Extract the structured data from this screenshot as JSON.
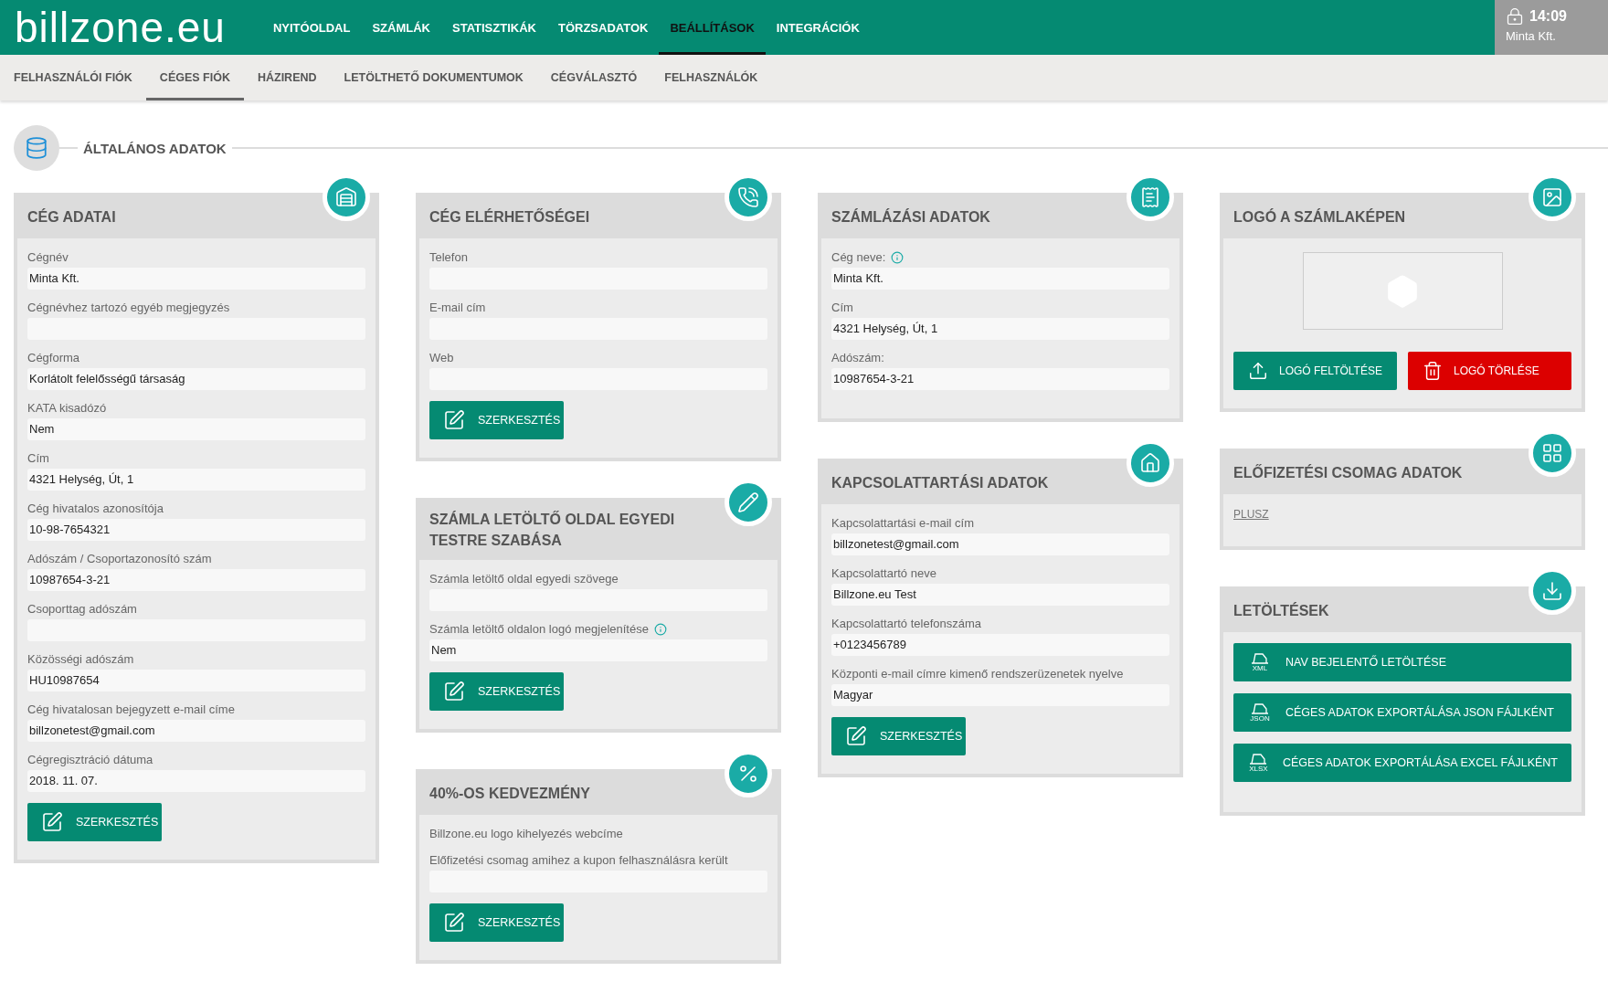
{
  "brand": "billzone.eu",
  "nav": [
    {
      "label": "NYITÓOLDAL",
      "selected": false
    },
    {
      "label": "SZÁMLÁK",
      "selected": false
    },
    {
      "label": "STATISZTIKÁK",
      "selected": false
    },
    {
      "label": "TÖRZSADATOK",
      "selected": false
    },
    {
      "label": "BEÁLLÍTÁSOK",
      "selected": true
    },
    {
      "label": "INTEGRÁCIÓK",
      "selected": false
    }
  ],
  "session": {
    "time": "14:09",
    "company": "Minta Kft."
  },
  "subnav": [
    {
      "label": "FELHASZNÁLÓI FIÓK",
      "selected": false
    },
    {
      "label": "CÉGES FIÓK",
      "selected": true
    },
    {
      "label": "HÁZIREND",
      "selected": false
    },
    {
      "label": "LETÖLTHETŐ DOKUMENTUMOK",
      "selected": false
    },
    {
      "label": "CÉGVÁLASZTÓ",
      "selected": false
    },
    {
      "label": "FELHASZNÁLÓK",
      "selected": false
    }
  ],
  "section": {
    "title": "ÁLTALÁNOS ADATOK"
  },
  "columns": [
    [
      {
        "kind": "form",
        "title": "CÉG ADATAI",
        "button": "SZERKESZTÉS",
        "fields": [
          {
            "kind": "input",
            "label": "Cégnév",
            "value": "Minta Kft.",
            "info": false
          },
          {
            "kind": "input",
            "label": "Cégnévhez tartozó egyéb megjegyzés",
            "info": false
          },
          {
            "kind": "input",
            "label": "Cégforma",
            "value": "Korlátolt felelősségű társaság",
            "info": false
          },
          {
            "kind": "input",
            "label": "KATA kisadózó",
            "value": "Nem",
            "info": false
          },
          {
            "kind": "input",
            "label": "Cím",
            "value": "4321 Helység, Út, 1",
            "info": false
          },
          {
            "kind": "input",
            "label": "Cég hivatalos azonosítója",
            "value": "10-98-7654321",
            "info": false
          },
          {
            "kind": "input",
            "label": "Adószám / Csoportazonosító szám",
            "value": "10987654-3-21",
            "info": false
          },
          {
            "kind": "input",
            "label": "Csoporttag adószám",
            "info": false
          },
          {
            "kind": "input",
            "label": "Közösségi adószám",
            "value": "HU10987654",
            "info": false
          },
          {
            "kind": "input",
            "label": "Cég hivatalosan bejegyzett e-mail címe",
            "value": "billzonetest@gmail.com",
            "info": false
          },
          {
            "kind": "input",
            "label": "Cégregisztráció dátuma",
            "value": "2018. 11. 07.",
            "info": false
          }
        ]
      }
    ],
    [
      {
        "kind": "form",
        "title": "CÉG ELÉRHETŐSÉGEI",
        "button": "SZERKESZTÉS",
        "fields": [
          {
            "kind": "input",
            "label": "Telefon",
            "info": false
          },
          {
            "kind": "input",
            "label": "E-mail cím",
            "info": false
          },
          {
            "kind": "input",
            "label": "Web",
            "info": false
          }
        ]
      },
      {
        "kind": "form",
        "title": "SZÁMLA LETÖLTŐ OLDAL EGYEDI TESTRE SZABÁSA",
        "button": "SZERKESZTÉS",
        "fields": [
          {
            "kind": "input",
            "label": "Számla letöltő oldal egyedi szövege",
            "info": false
          },
          {
            "kind": "input",
            "label": "Számla letöltő oldalon logó megjelenítése",
            "value": "Nem",
            "info": true
          }
        ]
      },
      {
        "kind": "form",
        "title": "40%-OS KEDVEZMÉNY",
        "button": "SZERKESZTÉS",
        "fields": [
          {
            "kind": "text",
            "label": "Billzone.eu logo kihelyezés webcíme",
            "info": false
          },
          {
            "kind": "input",
            "label": "Előfizetési csomag amihez a kupon felhasználásra került",
            "info": false
          }
        ]
      }
    ],
    [
      {
        "kind": "form",
        "title": "SZÁMLÁZÁSI ADATOK",
        "fields": [
          {
            "kind": "input",
            "label": "Cég neve:",
            "value": "Minta Kft.",
            "info": true
          },
          {
            "kind": "input",
            "label": "Cím",
            "value": "4321 Helység, Út, 1",
            "info": false
          },
          {
            "kind": "input",
            "label": "Adószám:",
            "value": "10987654-3-21",
            "info": false
          }
        ]
      },
      {
        "kind": "form",
        "title": "KAPCSOLATTARTÁSI ADATOK",
        "button": "SZERKESZTÉS",
        "fields": [
          {
            "kind": "input",
            "label": "Kapcsolattartási e-mail cím",
            "value": "billzonetest@gmail.com",
            "info": false
          },
          {
            "kind": "input",
            "label": "Kapcsolattartó neve",
            "value": "Billzone.eu Test",
            "info": false
          },
          {
            "kind": "input",
            "label": "Kapcsolattartó telefonszáma",
            "value": "+0123456789",
            "info": false
          },
          {
            "kind": "input",
            "label": "Központi e-mail címre kimenő rendszerüzenetek nyelve",
            "value": "Magyar",
            "info": false
          }
        ]
      }
    ],
    [
      {
        "kind": "logo",
        "title": "LOGÓ A SZÁMLAKÉPEN",
        "buttons": [
          {
            "kind": "upload",
            "label": "LOGÓ FELTÖLTÉSE"
          },
          {
            "kind": "delete",
            "label": "LOGÓ TÖRLÉSE"
          }
        ]
      },
      {
        "kind": "link",
        "title": "ELŐFIZETÉSI CSOMAG ADATOK",
        "link": "PLUSZ"
      },
      {
        "kind": "downloads",
        "title": "LETÖLTÉSEK",
        "buttons": [
          {
            "format": "XML",
            "label": "NAV BEJELENTŐ LETÖLTÉSE"
          },
          {
            "format": "JSON",
            "label": "CÉGES ADATOK EXPORTÁLÁSA JSON FÁJLKÉNT"
          },
          {
            "format": "XLSX",
            "label": "CÉGES ADATOK EXPORTÁLÁSA EXCEL FÁJLKÉNT"
          }
        ]
      }
    ]
  ]
}
